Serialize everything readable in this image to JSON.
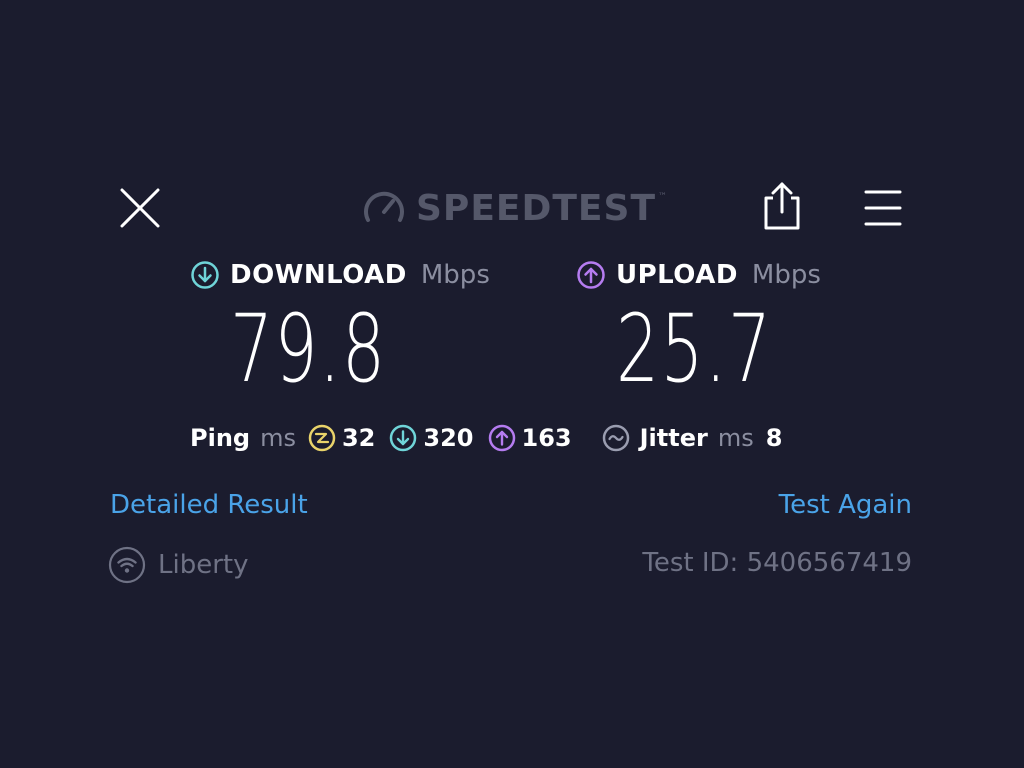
{
  "header": {
    "logo_text": "SPEEDTEST",
    "logo_mark": "™",
    "close_icon": "close-icon",
    "share_icon": "share-icon",
    "menu_icon": "menu-icon"
  },
  "download": {
    "label": "DOWNLOAD",
    "unit": "Mbps",
    "value": "79.8",
    "icon": "download-arrow-icon",
    "color": "#6fd4d8"
  },
  "upload": {
    "label": "UPLOAD",
    "unit": "Mbps",
    "value": "25.7",
    "icon": "upload-arrow-icon",
    "color": "#b57cf0"
  },
  "ping": {
    "label": "Ping",
    "unit": "ms",
    "idle": "32",
    "download": "320",
    "upload": "163",
    "idle_color": "#e9d36a"
  },
  "jitter": {
    "label": "Jitter",
    "unit": "ms",
    "value": "8"
  },
  "links": {
    "detailed": "Detailed Result",
    "test_again": "Test Again"
  },
  "provider": {
    "name": "Liberty",
    "icon": "wifi-icon"
  },
  "test_id": "Test ID: 5406567419",
  "colors": {
    "background": "#1b1c2e",
    "link": "#4aa3e8",
    "muted": "#6f7285"
  }
}
